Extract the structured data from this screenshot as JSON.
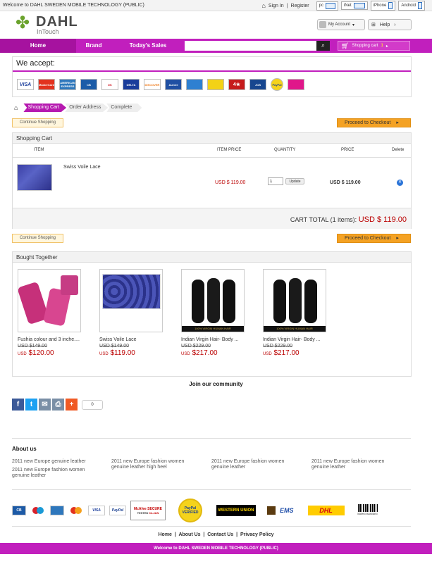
{
  "topbar": {
    "welcome": "Welcome to DAHL SWEDEN MOBILE TECHNOLOGY (PUBLIC)",
    "sign_in": "Sign In",
    "separator": "|",
    "register": "Register",
    "devices": [
      "pc",
      "iNet",
      "iPhone",
      "Android"
    ]
  },
  "header": {
    "logo_name": "DAHL",
    "logo_sub": "InTouch",
    "my_account": "My Account",
    "help": "Help"
  },
  "nav": {
    "items": [
      "Home",
      "Brand",
      "Today's Sales"
    ],
    "search_placeholder": "",
    "cart_label": "Shopping cart",
    "cart_count": "1"
  },
  "accept": {
    "title": "We accept:",
    "cards": [
      {
        "name": "VISA",
        "color": "#1a3d9b"
      },
      {
        "name": "MasterCard",
        "color": "#e2321f"
      },
      {
        "name": "AMERICAN EXPRESS",
        "color": "#2e77bc"
      },
      {
        "name": "CB",
        "color": "#1c5ca8"
      },
      {
        "name": "DK",
        "color": "#d3212b"
      },
      {
        "name": "DELTA",
        "color": "#1a3d9b"
      },
      {
        "name": "DISCOVER",
        "color": "#ef7a1a"
      },
      {
        "name": "Aurore",
        "color": "#1f4fa3"
      },
      {
        "name": "",
        "color": "#2e80d1"
      },
      {
        "name": "",
        "color": "#f3d216"
      },
      {
        "name": "4★",
        "color": "#c61b1b"
      },
      {
        "name": "JCB",
        "color": "#17468f"
      },
      {
        "name": "PayPal",
        "color": "#f5d31b"
      },
      {
        "name": "",
        "color": "#e0178a"
      }
    ]
  },
  "breadcrumb": {
    "steps": [
      "Shopping Cart",
      "Order Address",
      "Complete"
    ]
  },
  "buttons": {
    "continue": "Continue Shopping",
    "checkout": "Proceed to Checkout"
  },
  "cart": {
    "title": "Shopping Cart",
    "columns": [
      "ITEM",
      "ITEM PRICE",
      "QUANTITY",
      "PRICE",
      "Delete"
    ],
    "item": {
      "name": "Swiss Voile Lace",
      "unit_price": "USD $ 119.00",
      "quantity": "1",
      "update": "Update",
      "price": "USD $ 119.00"
    },
    "total_label": "CART TOTAL (1 items):",
    "total_value": "USD $ 119.00"
  },
  "bought": {
    "title": "Bought Together",
    "products": [
      {
        "name": "Fushia colour and 3 inche....",
        "old": "USD $149.00",
        "cur_unit": "USD",
        "cur": "$120.00"
      },
      {
        "name": "Swiss Voile Lace",
        "old": "USD $149.00",
        "cur_unit": "USD",
        "cur": "$119.00"
      },
      {
        "name": "Indian Virgin Hair- Body ...",
        "old": "USD $229.00",
        "cur_unit": "USD",
        "cur": "$217.00"
      },
      {
        "name": "Indian Virgin Hair- Body ...",
        "old": "USD $229.00",
        "cur_unit": "USD",
        "cur": "$217.00"
      }
    ],
    "hair_banner": "100% VIRGIN HUMAN HAIR"
  },
  "community": {
    "title": "Join our community",
    "share_count": "0"
  },
  "about": {
    "title": "About us",
    "links": [
      "2011 new Europe genuine leather",
      "2011 new Europe fashion women genuine leather high heel",
      "2011 new Europe fashion women genuine leather",
      "2011 new Europe fashion women genuine leather",
      "2011 new Europe fashion women genuine leather"
    ]
  },
  "bottom_cards": {
    "mcafee": "McAfee SECURE",
    "mcafee_tested": "TESTED",
    "mcafee_date": "04-JAN",
    "paypal": "PayPal VERIFIED",
    "western": "WESTERN UNION",
    "ems": "EMS",
    "dhl": "DHL",
    "boleto": "Boleto Bancario"
  },
  "footer": {
    "links": [
      "Home",
      "About Us",
      "Contact Us",
      "Privacy Policy"
    ],
    "bar": "Welcome to DAHL SWEDEN MOBILE TECHNOLOGY (PUBLIC)"
  }
}
